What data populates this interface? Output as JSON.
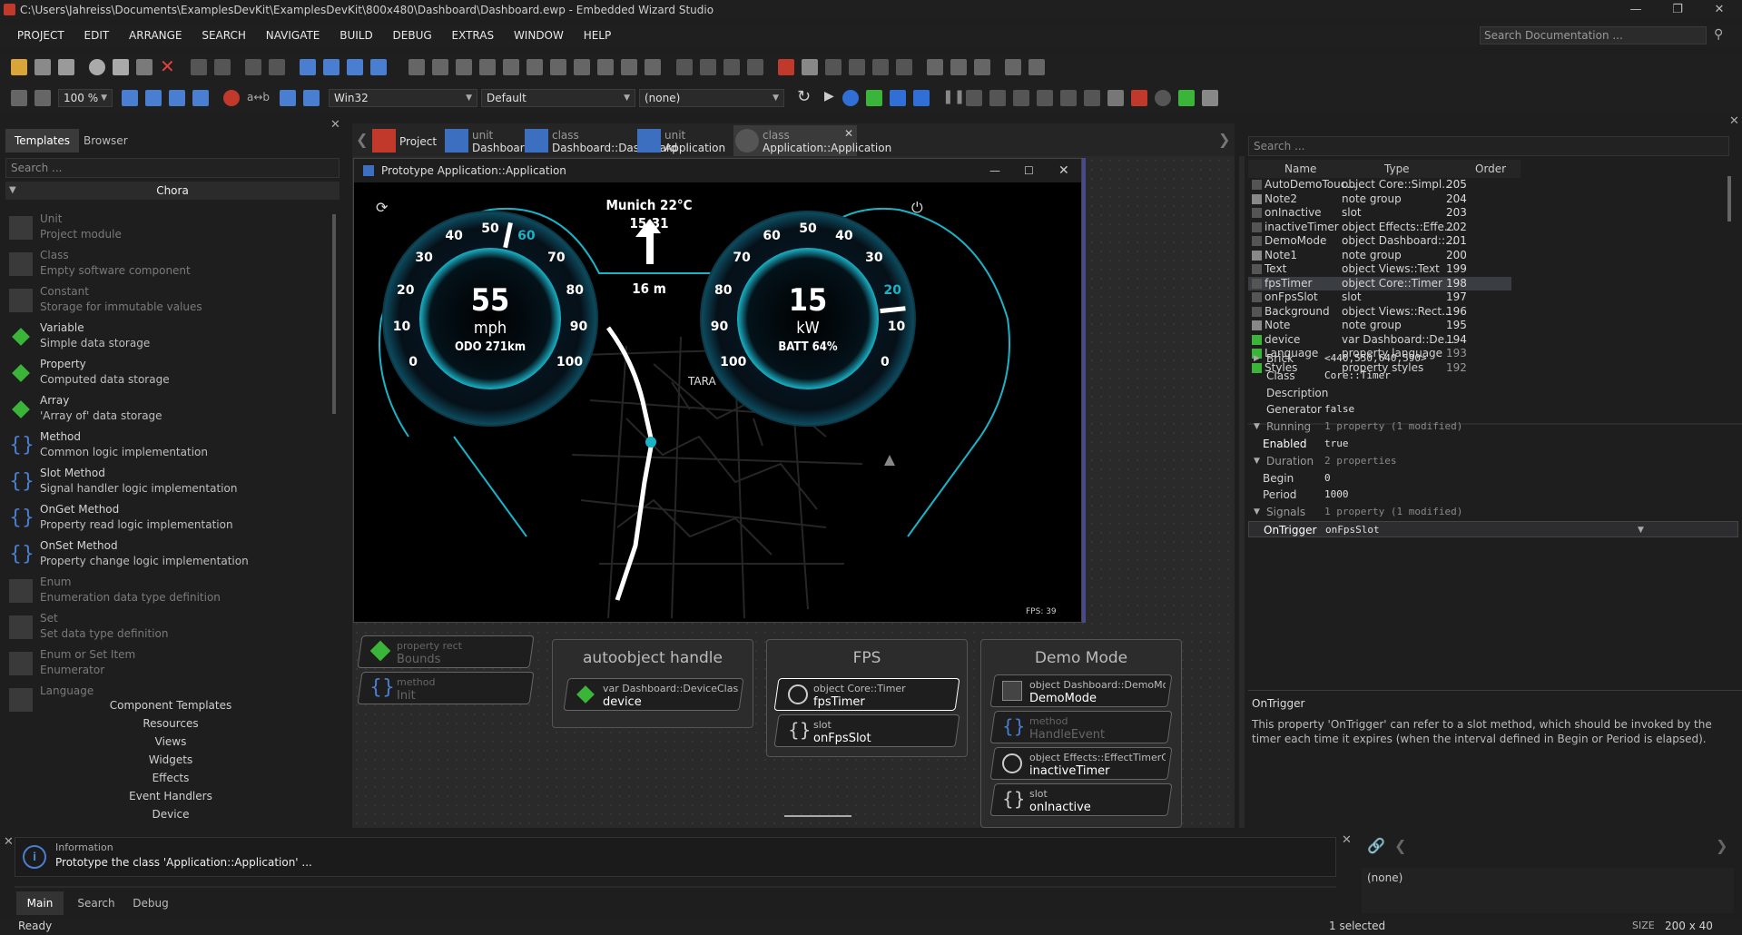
{
  "window": {
    "title": "C:\\Users\\Jahreiss\\Documents\\ExamplesDevKit\\ExamplesDevKit\\800x480\\Dashboard\\Dashboard.ewp - Embedded Wizard Studio"
  },
  "menu": [
    "PROJECT",
    "EDIT",
    "ARRANGE",
    "SEARCH",
    "NAVIGATE",
    "BUILD",
    "DEBUG",
    "EXTRAS",
    "WINDOW",
    "HELP"
  ],
  "doc_search": {
    "placeholder": "Search Documentation ..."
  },
  "toolbar": {
    "zoom": "100 %",
    "platform": "Win32",
    "style": "Default",
    "variant": "(none)",
    "ab_label": "a↔b"
  },
  "left_panel": {
    "tabs": [
      "Templates",
      "Browser"
    ],
    "search_placeholder": "Search ...",
    "category": "Chora",
    "templates": [
      {
        "name": "Unit",
        "desc": "Project module",
        "enabled": false,
        "icon": "unit-icon"
      },
      {
        "name": "Class",
        "desc": "Empty software component",
        "enabled": false,
        "icon": "class-icon"
      },
      {
        "name": "Constant",
        "desc": "Storage for immutable values",
        "enabled": false,
        "icon": "constant-icon"
      },
      {
        "name": "Variable",
        "desc": "Simple data storage",
        "enabled": true,
        "icon": "variable-icon"
      },
      {
        "name": "Property",
        "desc": "Computed data storage",
        "enabled": true,
        "icon": "property-icon"
      },
      {
        "name": "Array",
        "desc": "'Array of' data storage",
        "enabled": true,
        "icon": "array-icon"
      },
      {
        "name": "Method",
        "desc": "Common logic implementation",
        "enabled": true,
        "icon": "method-icon"
      },
      {
        "name": "Slot Method",
        "desc": "Signal handler logic implementation",
        "enabled": true,
        "icon": "slot-method-icon"
      },
      {
        "name": "OnGet Method",
        "desc": "Property read logic implementation",
        "enabled": true,
        "icon": "onget-method-icon"
      },
      {
        "name": "OnSet Method",
        "desc": "Property change logic implementation",
        "enabled": true,
        "icon": "onset-method-icon"
      },
      {
        "name": "Enum",
        "desc": "Enumeration data type definition",
        "enabled": false,
        "icon": "enum-icon"
      },
      {
        "name": "Set",
        "desc": "Set data type definition",
        "enabled": false,
        "icon": "set-icon"
      },
      {
        "name": "Enum or Set Item",
        "desc": "Enumerator",
        "enabled": false,
        "icon": "enum-item-icon"
      },
      {
        "name": "Language",
        "desc": "",
        "enabled": false,
        "icon": "language-icon"
      }
    ],
    "categories": [
      "Component Templates",
      "Resources",
      "Views",
      "Widgets",
      "Effects",
      "Event Handlers",
      "Device"
    ]
  },
  "editor_tabs": [
    {
      "kind": "",
      "name": "Project",
      "icon": "project-icon"
    },
    {
      "kind": "unit",
      "name": "Dashboard",
      "icon": "unit-icon"
    },
    {
      "kind": "class",
      "name": "Dashboard::Dashboard",
      "icon": "class-icon"
    },
    {
      "kind": "unit",
      "name": "Application",
      "icon": "unit-icon"
    },
    {
      "kind": "class",
      "name": "Application::Application",
      "icon": "class-icon",
      "active": true
    }
  ],
  "prototype": {
    "title": "Prototype Application::Application",
    "city_temp": "Munich 22°C",
    "time": "15:31",
    "distance": "16 m",
    "map_label": "TARA",
    "fps": "FPS: 39",
    "speed": {
      "value": "55",
      "unit": "mph",
      "sub": "ODO 271km",
      "level": 55,
      "ticks": [
        "0",
        "10",
        "20",
        "30",
        "40",
        "50",
        "60",
        "70",
        "80",
        "90",
        "100"
      ]
    },
    "power": {
      "value": "15",
      "unit": "kW",
      "sub": "BATT 64%",
      "level": 15,
      "ticks": [
        "0",
        "10",
        "20",
        "30",
        "40",
        "50",
        "60",
        "70",
        "80",
        "90",
        "100"
      ]
    }
  },
  "nodes": {
    "left_group": [
      {
        "kind": "property rect",
        "name": "Bounds"
      },
      {
        "kind": "method",
        "name": "Init"
      }
    ],
    "autoobject": {
      "title": "autoobject handle",
      "members": [
        {
          "kind": "var Dashboard::DeviceClass",
          "name": "device"
        }
      ]
    },
    "fps": {
      "title": "FPS",
      "members": [
        {
          "kind": "object Core::Timer",
          "name": "fpsTimer"
        },
        {
          "kind": "slot",
          "name": "onFpsSlot"
        }
      ]
    },
    "demo": {
      "title": "Demo Mode",
      "members": [
        {
          "kind": "object Dashboard::DemoMo",
          "name": "DemoMode"
        },
        {
          "kind": "method",
          "name": "HandleEvent"
        },
        {
          "kind": "object Effects::EffectTimerC",
          "name": "inactiveTimer"
        },
        {
          "kind": "slot",
          "name": "onInactive"
        }
      ]
    }
  },
  "members": {
    "search_placeholder": "Search ...",
    "headers": [
      "Name",
      "Type",
      "Order"
    ],
    "rows": [
      {
        "name": "AutoDemoTouc...",
        "type": "object Core::Simpl...",
        "order": "205"
      },
      {
        "name": "Note2",
        "type": "note group",
        "order": "204"
      },
      {
        "name": "onInactive",
        "type": "slot",
        "order": "203"
      },
      {
        "name": "inactiveTimer",
        "type": "object Effects::Effe...",
        "order": "202"
      },
      {
        "name": "DemoMode",
        "type": "object Dashboard::...",
        "order": "201"
      },
      {
        "name": "Note1",
        "type": "note group",
        "order": "200"
      },
      {
        "name": "Text",
        "type": "object Views::Text",
        "order": "199"
      },
      {
        "name": "fpsTimer",
        "type": "object Core::Timer",
        "order": "198",
        "selected": true
      },
      {
        "name": "onFpsSlot",
        "type": "slot",
        "order": "197"
      },
      {
        "name": "Background",
        "type": "object Views::Rect...",
        "order": "196"
      },
      {
        "name": "Note",
        "type": "note group",
        "order": "195"
      },
      {
        "name": "device",
        "type": "var Dashboard::De...",
        "order": "194"
      },
      {
        "name": "Language",
        "type": "property language",
        "order": "193"
      },
      {
        "name": "Styles",
        "type": "property styles",
        "order": "192"
      }
    ]
  },
  "inspector": {
    "rows": [
      {
        "key": "Brick",
        "value": "<440,550,640,590>",
        "expander": "right"
      },
      {
        "key": "Class",
        "value": "Core::Timer"
      },
      {
        "key": "Description",
        "value": ""
      },
      {
        "key": "Generator",
        "value": "false"
      },
      {
        "key": "Running",
        "value": "1 property (1 modified)",
        "expander": "down",
        "dim": true
      },
      {
        "key": "Enabled",
        "value": "true",
        "indent": true,
        "bold": true
      },
      {
        "key": "Duration",
        "value": "2 properties",
        "expander": "down",
        "dim": true
      },
      {
        "key": "Begin",
        "value": "0",
        "indent": true
      },
      {
        "key": "Period",
        "value": "1000",
        "indent": true
      },
      {
        "key": "Signals",
        "value": "1 property (1 modified)",
        "expander": "down",
        "dim": true
      },
      {
        "key": "OnTrigger",
        "value": "onFpsSlot",
        "indent": true,
        "bold": true,
        "selected": true
      }
    ],
    "help_title": "OnTrigger",
    "help_text": "This property 'OnTrigger' can refer to a slot method, which should be invoked by the timer each time it expires (when the interval defined in Begin or Period is elapsed)."
  },
  "log": {
    "kind": "Information",
    "text": "Prototype the class 'Application::Application' ..."
  },
  "bottom_tabs": [
    "Main",
    "Search",
    "Debug"
  ],
  "none_value": "(none)",
  "status": {
    "left": "Ready",
    "middle": "1 selected",
    "size_label": "SIZE",
    "size_value": "200 x 40"
  },
  "colors": {
    "accent": "#1ab3c8",
    "selection": "#3a3d41",
    "variable_green": "#3ab53a",
    "brick_blue": "#3c6fbf"
  }
}
